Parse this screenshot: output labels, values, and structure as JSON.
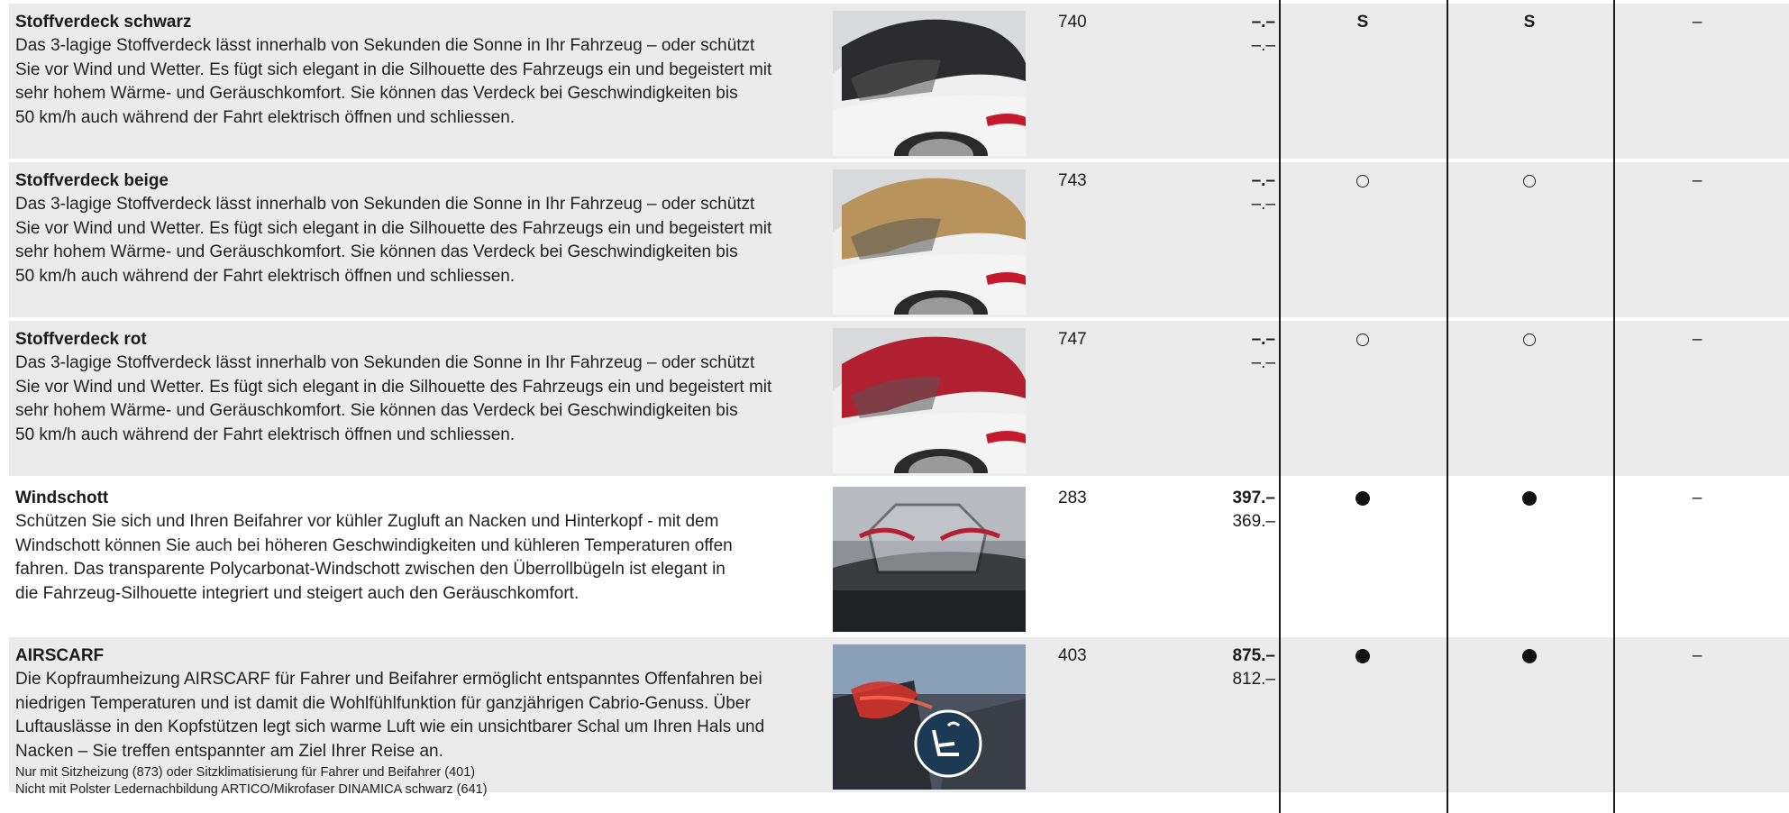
{
  "rows": [
    {
      "title": "Stoffverdeck schwarz",
      "desc": [
        "Das 3-lagige Stoffverdeck lässt innerhalb von Sekunden die Sonne in Ihr Fahrzeug – oder schützt",
        "Sie vor Wind und Wetter. Es fügt sich elegant in die Silhouette des Fahrzeugs ein und begeistert mit",
        "sehr hohem Wärme- und Geräuschkomfort. Sie können das Verdeck bei Geschwindigkeiten bis",
        "50 km/h auch während der Fahrt elektrisch öffnen und schliessen."
      ],
      "notes": [],
      "code": "740",
      "price_primary": "–.–",
      "price_secondary": "–.–",
      "col1": "S",
      "col2": "S",
      "col3": "–",
      "roof_color": "#2b2b2d",
      "thumb": "car-black-roof"
    },
    {
      "title": "Stoffverdeck beige",
      "desc": [
        "Das 3-lagige Stoffverdeck lässt innerhalb von Sekunden die Sonne in Ihr Fahrzeug – oder schützt",
        "Sie vor Wind und Wetter. Es fügt sich elegant in die Silhouette des Fahrzeugs ein und begeistert mit",
        "sehr hohem Wärme- und Geräuschkomfort. Sie können das Verdeck bei Geschwindigkeiten bis",
        "50 km/h auch während der Fahrt elektrisch öffnen und schliessen."
      ],
      "notes": [],
      "code": "743",
      "price_primary": "–.–",
      "price_secondary": "–.–",
      "col1": "○",
      "col2": "○",
      "col3": "–",
      "roof_color": "#b8945c",
      "thumb": "car-beige-roof"
    },
    {
      "title": "Stoffverdeck rot",
      "desc": [
        "Das 3-lagige Stoffverdeck lässt innerhalb von Sekunden die Sonne in Ihr Fahrzeug – oder schützt",
        "Sie vor Wind und Wetter. Es fügt sich elegant in die Silhouette des Fahrzeugs ein und begeistert mit",
        "sehr hohem Wärme- und Geräuschkomfort. Sie können das Verdeck bei Geschwindigkeiten bis",
        "50 km/h auch während der Fahrt elektrisch öffnen und schliessen."
      ],
      "notes": [],
      "code": "747",
      "price_primary": "–.–",
      "price_secondary": "–.–",
      "col1": "○",
      "col2": "○",
      "col3": "–",
      "roof_color": "#b02030",
      "thumb": "car-red-roof"
    },
    {
      "title": "Windschott",
      "desc": [
        "Schützen Sie sich und Ihren Beifahrer vor kühler Zugluft an Nacken und Hinterkopf - mit dem",
        "Windschott können Sie auch bei höheren Geschwindigkeiten und kühleren Temperaturen offen",
        "fahren. Das transparente Polycarbonat-Windschott zwischen den Überrollbügeln ist elegant in",
        "die Fahrzeug-Silhouette integriert und steigert auch den Geräuschkomfort."
      ],
      "notes": [],
      "code": "283",
      "price_primary": "397.–",
      "price_secondary": "369.–",
      "col1": "●",
      "col2": "●",
      "col3": "–",
      "thumb": "windscreen-photo"
    },
    {
      "title": "AIRSCARF",
      "desc": [
        "Die Kopfraumheizung AIRSCARF für Fahrer und Beifahrer ermöglicht entspanntes Offenfahren bei",
        "niedrigen Temperaturen und ist damit die Wohlfühlfunktion für ganzjährigen Cabrio-Genuss. Über",
        "Luftauslässe in den Kopfstützen legt sich warme Luft wie ein unsichtbarer Schal um Ihren Hals und",
        "Nacken – Sie treffen entspannter am Ziel Ihrer Reise an."
      ],
      "notes": [
        "Nur mit Sitzheizung (873) oder Sitzklimatisierung für Fahrer und Beifahrer (401)",
        "Nicht mit Polster Ledernachbildung ARTICO/Mikrofaser DINAMICA schwarz (641)"
      ],
      "code": "403",
      "price_primary": "875.–",
      "price_secondary": "812.–",
      "col1": "●",
      "col2": "●",
      "col3": "–",
      "thumb": "airscarf-photo"
    }
  ],
  "colors": {
    "shade": "#ebebeb",
    "rule": "#1a1a1a"
  }
}
